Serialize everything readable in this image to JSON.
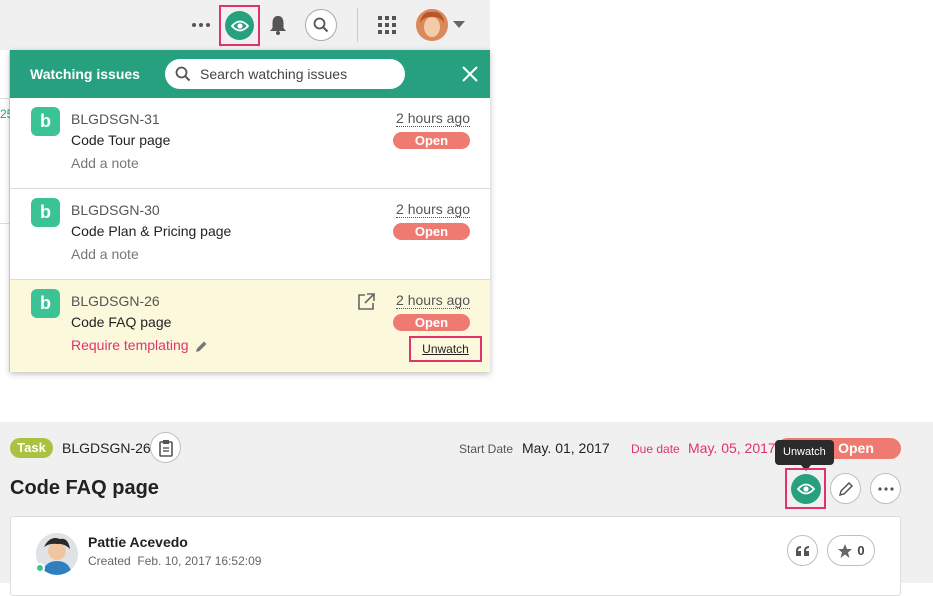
{
  "colors": {
    "accent": "#27a080",
    "status_open": "#ee7a72",
    "highlight": "#e0336e",
    "task_badge": "#a9c23f",
    "alert_red": "#e0336e"
  },
  "topbar": {
    "icons": [
      "more-icon",
      "eye-icon",
      "bell-icon",
      "search-icon",
      "apps-grid-icon",
      "avatar",
      "chevron-down-icon"
    ]
  },
  "panel": {
    "title": "Watching issues",
    "search_placeholder": "Search watching issues",
    "items": [
      {
        "key": "BLGDSGN-31",
        "title": "Code Tour page",
        "note": "Add a note",
        "time": "2 hours ago",
        "status": "Open"
      },
      {
        "key": "BLGDSGN-30",
        "title": "Code Plan & Pricing page",
        "note": "Add a note",
        "time": "2 hours ago",
        "status": "Open"
      },
      {
        "key": "BLGDSGN-26",
        "title": "Code FAQ page",
        "note": "Require templating",
        "time": "2 hours ago",
        "status": "Open",
        "action": "Unwatch"
      }
    ],
    "logo_letter": "b",
    "left_fragment": "25"
  },
  "issue": {
    "type_badge": "Task",
    "key": "BLGDSGN-26",
    "start_label": "Start Date",
    "start_value": "May. 01, 2017",
    "due_label": "Due date",
    "due_value": "May. 05, 2017",
    "status": "Open",
    "title": "Code FAQ page",
    "tooltip": "Unwatch",
    "comment": {
      "author": "Pattie Acevedo",
      "created": "Created  Feb. 10, 2017 16:52:09",
      "star_count": "0"
    }
  }
}
